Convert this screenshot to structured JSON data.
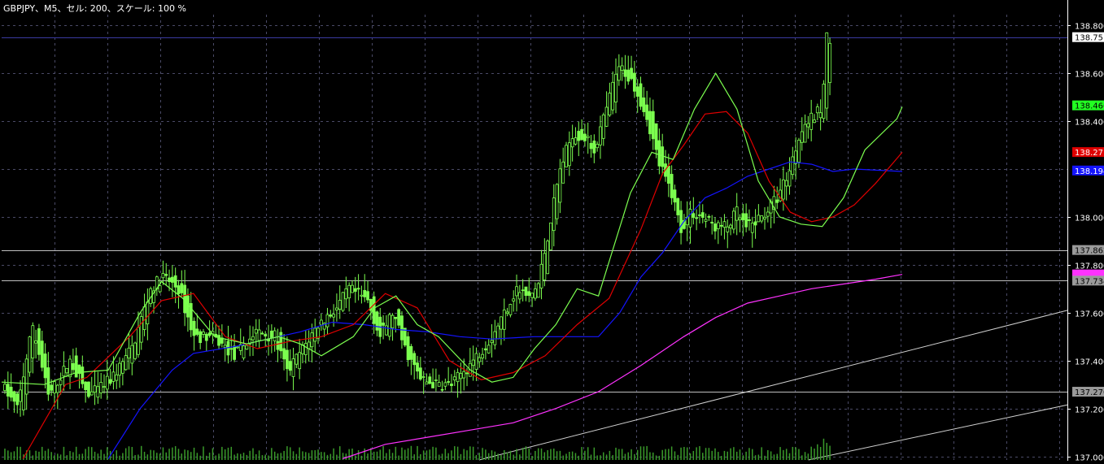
{
  "window": {
    "title": "GBPJPY、M5、セル: 200、スケール: 100 %"
  },
  "colors": {
    "background": "#000000",
    "grid": "#4a4a66",
    "axis_text": "#ffffff",
    "candle": "#7cff4f",
    "ma_fast": "#7cff4f",
    "ma_mid": "#e00000",
    "ma_slow": "#1414ff",
    "ma_long": "#ff32ff",
    "hline": "#bfbfbf",
    "top_hline": "#3a3aa0",
    "trendline": "#d0d0d0",
    "volume": "#3a9a2a"
  },
  "chart_data": {
    "type": "candlestick",
    "symbol": "GBPJPY",
    "timeframe": "M5",
    "ylim": [
      136.985,
      138.845
    ],
    "y_ticks": [
      {
        "value": 138.8,
        "label": "138.800"
      },
      {
        "value": 138.6,
        "label": "138.600"
      },
      {
        "value": 138.4,
        "label": "138.400"
      },
      {
        "value": 138.0,
        "label": "138.000"
      },
      {
        "value": 137.8,
        "label": "137.800"
      },
      {
        "value": 137.6,
        "label": "137.600"
      },
      {
        "value": 137.4,
        "label": "137.400"
      },
      {
        "value": 137.2,
        "label": "137.200"
      },
      {
        "value": 137.0,
        "label": "137.000"
      }
    ],
    "price_labels": [
      {
        "value": 138.751,
        "label": "138.751",
        "bg": "#ffffff",
        "fg": "#000000"
      },
      {
        "value": 138.466,
        "label": "138.466",
        "bg": "#22ff22",
        "fg": "#000000"
      },
      {
        "value": 138.271,
        "label": "138.271",
        "bg": "#e00000",
        "fg": "#ffffff"
      },
      {
        "value": 138.194,
        "label": "138.194",
        "bg": "#1414ff",
        "fg": "#ffffff"
      },
      {
        "value": 137.862,
        "label": "137.862",
        "bg": "#9a9a9a",
        "fg": "#000000"
      },
      {
        "value": 137.76,
        "label": "",
        "bg": "#ff32ff",
        "fg": "#000000"
      },
      {
        "value": 137.734,
        "label": "137.734",
        "bg": "#9a9a9a",
        "fg": "#000000"
      },
      {
        "value": 137.27,
        "label": "137.270",
        "bg": "#9a9a9a",
        "fg": "#000000"
      }
    ],
    "hlines": [
      137.862,
      137.734,
      137.27
    ],
    "top_hline": 138.751,
    "trendlines": [
      {
        "x": [
          0.448,
          1.0
        ],
        "y": [
          136.985,
          137.61
        ]
      },
      {
        "x": [
          0.757,
          1.0
        ],
        "y": [
          136.985,
          137.215
        ]
      }
    ],
    "candle_count": 200,
    "candle_anchors": [
      [
        0,
        137.3
      ],
      [
        5,
        137.2
      ],
      [
        10,
        137.55
      ],
      [
        15,
        137.25
      ],
      [
        22,
        137.4
      ],
      [
        28,
        137.25
      ],
      [
        35,
        137.32
      ],
      [
        42,
        137.45
      ],
      [
        48,
        137.7
      ],
      [
        52,
        137.75
      ],
      [
        57,
        137.7
      ],
      [
        62,
        137.5
      ],
      [
        68,
        137.5
      ],
      [
        75,
        137.42
      ],
      [
        82,
        137.52
      ],
      [
        88,
        137.5
      ],
      [
        92,
        137.35
      ],
      [
        97,
        137.45
      ],
      [
        102,
        137.55
      ],
      [
        108,
        137.62
      ],
      [
        112,
        137.7
      ],
      [
        118,
        137.65
      ],
      [
        122,
        137.5
      ],
      [
        126,
        137.6
      ],
      [
        130,
        137.45
      ],
      [
        135,
        137.32
      ],
      [
        140,
        137.3
      ],
      [
        145,
        137.3
      ],
      [
        152,
        137.4
      ],
      [
        158,
        137.5
      ],
      [
        162,
        137.6
      ],
      [
        166,
        137.7
      ],
      [
        170,
        137.66
      ],
      [
        173,
        137.72
      ],
      [
        176,
        137.92
      ],
      [
        180,
        138.2
      ],
      [
        184,
        138.35
      ],
      [
        188,
        138.33
      ],
      [
        191,
        138.28
      ],
      [
        195,
        138.45
      ],
      [
        198,
        138.6
      ],
      [
        200,
        138.62
      ],
      [
        204,
        138.55
      ],
      [
        208,
        138.42
      ],
      [
        212,
        138.22
      ],
      [
        216,
        138.1
      ],
      [
        219,
        137.95
      ],
      [
        222,
        138.02
      ],
      [
        226,
        138.0
      ],
      [
        230,
        137.96
      ],
      [
        234,
        137.96
      ],
      [
        237,
        138.02
      ],
      [
        240,
        137.95
      ],
      [
        245,
        138.0
      ],
      [
        250,
        138.08
      ],
      [
        254,
        138.2
      ],
      [
        258,
        138.38
      ],
      [
        262,
        138.42
      ],
      [
        264,
        138.45
      ],
      [
        265,
        138.55
      ],
      [
        266,
        138.75
      ]
    ],
    "candles_visible_fraction": 0.777,
    "ma_fast": [
      [
        0.0,
        137.31
      ],
      [
        0.04,
        137.3
      ],
      [
        0.07,
        137.35
      ],
      [
        0.1,
        137.36
      ],
      [
        0.13,
        137.6
      ],
      [
        0.15,
        137.73
      ],
      [
        0.17,
        137.66
      ],
      [
        0.2,
        137.5
      ],
      [
        0.23,
        137.47
      ],
      [
        0.26,
        137.5
      ],
      [
        0.28,
        137.47
      ],
      [
        0.3,
        137.42
      ],
      [
        0.33,
        137.5
      ],
      [
        0.35,
        137.62
      ],
      [
        0.37,
        137.67
      ],
      [
        0.39,
        137.55
      ],
      [
        0.41,
        137.5
      ],
      [
        0.44,
        137.36
      ],
      [
        0.46,
        137.31
      ],
      [
        0.48,
        137.33
      ],
      [
        0.5,
        137.45
      ],
      [
        0.52,
        137.55
      ],
      [
        0.54,
        137.7
      ],
      [
        0.56,
        137.67
      ],
      [
        0.59,
        138.1
      ],
      [
        0.61,
        138.27
      ],
      [
        0.63,
        138.24
      ],
      [
        0.65,
        138.45
      ],
      [
        0.67,
        138.6
      ],
      [
        0.69,
        138.45
      ],
      [
        0.71,
        138.15
      ],
      [
        0.73,
        138.0
      ],
      [
        0.75,
        137.97
      ],
      [
        0.77,
        137.96
      ],
      [
        0.79,
        138.08
      ],
      [
        0.81,
        138.28
      ],
      [
        0.84,
        138.41
      ],
      [
        0.845,
        138.46
      ]
    ],
    "ma_mid": [
      [
        0.02,
        136.99
      ],
      [
        0.06,
        137.3
      ],
      [
        0.08,
        137.33
      ],
      [
        0.12,
        137.5
      ],
      [
        0.15,
        137.65
      ],
      [
        0.18,
        137.68
      ],
      [
        0.21,
        137.5
      ],
      [
        0.24,
        137.45
      ],
      [
        0.27,
        137.48
      ],
      [
        0.3,
        137.5
      ],
      [
        0.33,
        137.55
      ],
      [
        0.36,
        137.68
      ],
      [
        0.39,
        137.62
      ],
      [
        0.42,
        137.4
      ],
      [
        0.45,
        137.32
      ],
      [
        0.48,
        137.35
      ],
      [
        0.51,
        137.42
      ],
      [
        0.54,
        137.55
      ],
      [
        0.57,
        137.66
      ],
      [
        0.6,
        137.95
      ],
      [
        0.62,
        138.18
      ],
      [
        0.64,
        138.3
      ],
      [
        0.66,
        138.43
      ],
      [
        0.68,
        138.44
      ],
      [
        0.7,
        138.35
      ],
      [
        0.72,
        138.15
      ],
      [
        0.74,
        138.02
      ],
      [
        0.76,
        137.98
      ],
      [
        0.78,
        138.0
      ],
      [
        0.8,
        138.05
      ],
      [
        0.82,
        138.14
      ],
      [
        0.845,
        138.27
      ]
    ],
    "ma_slow": [
      [
        0.1,
        136.99
      ],
      [
        0.13,
        137.2
      ],
      [
        0.16,
        137.36
      ],
      [
        0.18,
        137.43
      ],
      [
        0.22,
        137.46
      ],
      [
        0.25,
        137.49
      ],
      [
        0.28,
        137.52
      ],
      [
        0.31,
        137.56
      ],
      [
        0.34,
        137.55
      ],
      [
        0.37,
        137.53
      ],
      [
        0.4,
        137.52
      ],
      [
        0.43,
        137.5
      ],
      [
        0.46,
        137.49
      ],
      [
        0.5,
        137.5
      ],
      [
        0.53,
        137.5
      ],
      [
        0.56,
        137.5
      ],
      [
        0.58,
        137.6
      ],
      [
        0.6,
        137.75
      ],
      [
        0.62,
        137.85
      ],
      [
        0.64,
        137.98
      ],
      [
        0.66,
        138.08
      ],
      [
        0.68,
        138.12
      ],
      [
        0.7,
        138.17
      ],
      [
        0.72,
        138.2
      ],
      [
        0.74,
        138.23
      ],
      [
        0.76,
        138.22
      ],
      [
        0.78,
        138.19
      ],
      [
        0.8,
        138.2
      ],
      [
        0.845,
        138.19
      ]
    ],
    "ma_long": [
      [
        0.32,
        136.99
      ],
      [
        0.36,
        137.05
      ],
      [
        0.4,
        137.08
      ],
      [
        0.44,
        137.11
      ],
      [
        0.48,
        137.14
      ],
      [
        0.52,
        137.2
      ],
      [
        0.56,
        137.27
      ],
      [
        0.6,
        137.38
      ],
      [
        0.64,
        137.5
      ],
      [
        0.67,
        137.58
      ],
      [
        0.7,
        137.64
      ],
      [
        0.73,
        137.67
      ],
      [
        0.76,
        137.7
      ],
      [
        0.79,
        137.72
      ],
      [
        0.82,
        137.74
      ],
      [
        0.845,
        137.76
      ]
    ],
    "volume_max_fraction": 0.045
  }
}
